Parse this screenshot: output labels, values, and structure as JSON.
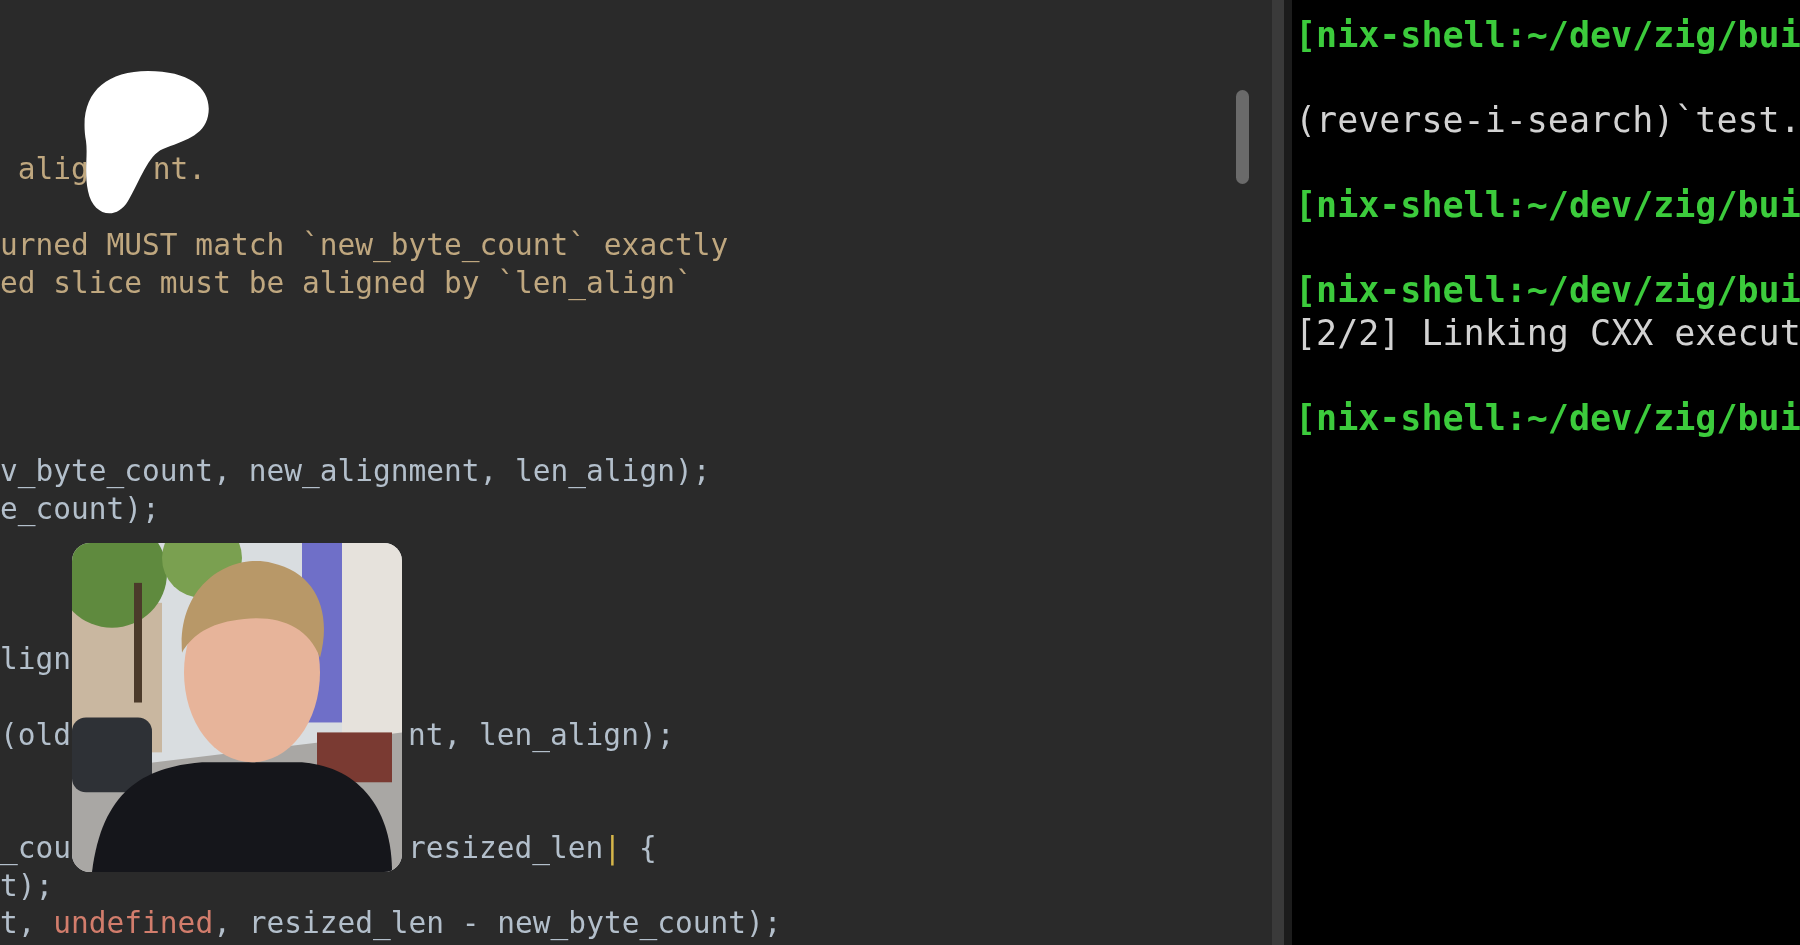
{
  "editor": {
    "lines": [
      {
        "kind": "blank"
      },
      {
        "kind": "blank"
      },
      {
        "kind": "blank"
      },
      {
        "kind": "blank"
      },
      {
        "kind": "code",
        "segments": [
          {
            "text": " alig",
            "color": "#bfa77f"
          },
          {
            "text": "nt.",
            "color": "#bfa77f",
            "kind": "after_blob"
          }
        ]
      },
      {
        "kind": "blank"
      },
      {
        "kind": "code",
        "segments": [
          {
            "text": "urned MUST match `new_byte_count` exactly",
            "color": "#bfa77f"
          }
        ]
      },
      {
        "kind": "code",
        "segments": [
          {
            "text": "ed slice must be aligned by `len_align`",
            "color": "#bfa77f"
          }
        ]
      },
      {
        "kind": "blank"
      },
      {
        "kind": "blank"
      },
      {
        "kind": "blank"
      },
      {
        "kind": "blank"
      },
      {
        "kind": "code",
        "segments": [
          {
            "text": "v_byte_count, new_alignment, len_align);",
            "color": "#b3bfcb"
          }
        ]
      },
      {
        "kind": "code",
        "segments": [
          {
            "text": "e_count);",
            "color": "#b3bfcb"
          }
        ]
      },
      {
        "kind": "blank"
      },
      {
        "kind": "blank"
      },
      {
        "kind": "blank"
      },
      {
        "kind": "code",
        "segments": [
          {
            "text": "lign",
            "color": "#b3bfcb"
          }
        ]
      },
      {
        "kind": "blank"
      },
      {
        "kind": "code",
        "segments": [
          {
            "text": "(old",
            "color": "#b3bfcb"
          },
          {
            "text": "nt, len_align);",
            "color": "#b3bfcb",
            "kind": "after_webcam"
          }
        ]
      },
      {
        "kind": "blank"
      },
      {
        "kind": "blank"
      },
      {
        "kind": "code",
        "segments": [
          {
            "text": "_cou",
            "color": "#b3bfcb"
          },
          {
            "text": "resized_len",
            "color": "#b3bfcb",
            "kind": "after_webcam"
          },
          {
            "text": "|",
            "color": "#d6b64a"
          },
          {
            "text": " {",
            "color": "#b3bfcb"
          }
        ]
      },
      {
        "kind": "code",
        "segments": [
          {
            "text": "t);",
            "color": "#b3bfcb"
          }
        ]
      },
      {
        "kind": "code",
        "segments": [
          {
            "text": "t, ",
            "color": "#b3bfcb"
          },
          {
            "text": "undefined",
            "color": "#d27d6c"
          },
          {
            "text": ", resized_len - new_byte_count);",
            "color": "#b3bfcb"
          }
        ]
      }
    ]
  },
  "terminal": {
    "lines": [
      {
        "kind": "prompt",
        "text": "[nix-shell:~/dev/zig/bui"
      },
      {
        "kind": "blank"
      },
      {
        "kind": "output",
        "text": "(reverse-i-search)`test."
      },
      {
        "kind": "blank"
      },
      {
        "kind": "prompt",
        "text": "[nix-shell:~/dev/zig/bui"
      },
      {
        "kind": "blank"
      },
      {
        "kind": "prompt",
        "text": "[nix-shell:~/dev/zig/bui"
      },
      {
        "kind": "output",
        "text": "[2/2] Linking CXX execut"
      },
      {
        "kind": "blank"
      },
      {
        "kind": "prompt",
        "text": "[nix-shell:~/dev/zig/bui"
      }
    ]
  }
}
